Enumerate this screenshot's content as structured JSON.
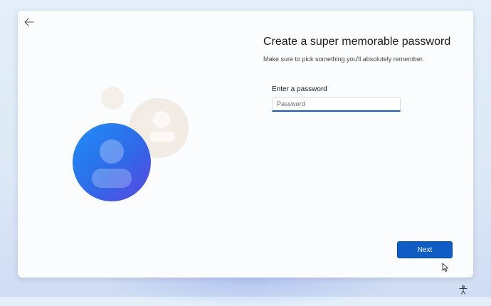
{
  "page": {
    "title": "Create a super memorable password",
    "subtitle": "Make sure to pick something you'll absolutely remember."
  },
  "password_field": {
    "label": "Enter a password",
    "placeholder": "Password",
    "value": ""
  },
  "buttons": {
    "next_label": "Next"
  },
  "icons": {
    "back": "arrow-left-icon",
    "avatar": "user-avatar-icon",
    "accessibility": "accessibility-icon",
    "cursor": "mouse-pointer-icon"
  },
  "colors": {
    "accent": "#0f5cc5",
    "avatar_gradient_start": "#2a8af5",
    "avatar_gradient_end": "#5b45e0"
  }
}
